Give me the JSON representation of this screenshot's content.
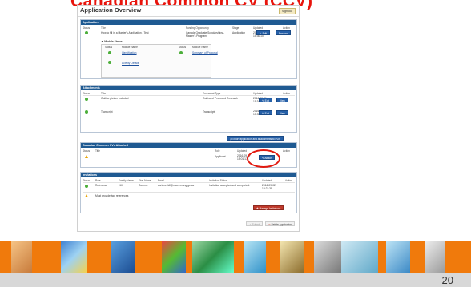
{
  "slide": {
    "title": "Canadian Common CV (CCV)",
    "page_number": "20"
  },
  "app": {
    "title": "Application Overview",
    "signout_label": "Sign out"
  },
  "application": {
    "section": "Application",
    "headers": [
      "Status",
      "Title",
      "Funding Opportunity",
      "Stage",
      "Updated",
      "Action"
    ],
    "row": {
      "title": "How to fill in a Master's Application - Test",
      "funding": "Canada Graduate Scholarships - Master's Program",
      "stage": "Application",
      "updated": "2016-09-01 15:30:10",
      "edit_label": "Edit",
      "preview_label": "Preview"
    },
    "module_status_label": "Module Status",
    "module_headers": [
      "Status",
      "Module Name",
      "Status",
      "Module Name"
    ],
    "modules": [
      "Identification",
      "Summary of Proposal",
      "Activity Details"
    ]
  },
  "attachments": {
    "section": "Attachments",
    "headers": [
      "Status",
      "Title",
      "Document Type",
      "Updated",
      "Action"
    ],
    "rows": [
      {
        "title": "Outline picture included",
        "doc_type": "Outline of Proposed Research",
        "updated": "2016-09-01 15:34:34",
        "edit": "Edit",
        "view": "View"
      },
      {
        "title": "Transcript",
        "doc_type": "Transcripts",
        "updated": "2016-09-01 15:35:48",
        "edit": "Edit",
        "view": "View"
      }
    ],
    "export_label": "Export application and attachments to PDF"
  },
  "ccv": {
    "section": "Canadian Common CVs Attached",
    "headers": [
      "Status",
      "Title",
      "Role",
      "Updated",
      "Action"
    ],
    "row": {
      "role": "Applicant",
      "updated": "2016-09-07 15:01:17",
      "attach_label": "Attach"
    }
  },
  "invitations": {
    "section": "Invitations",
    "headers": [
      "Status",
      "Role",
      "Family Name",
      "First Name",
      "Email",
      "Invitation Status",
      "Updated",
      "Action"
    ],
    "row": {
      "role": "Reference",
      "family": "Hill",
      "first": "Corinne",
      "email": "corinne.hill@nserc-crsng.gc.ca",
      "status": "Invitation accepted and completed.",
      "updated": "2016-09-02 13:21:39"
    },
    "warning": "Must provide two references",
    "manage_label": "Manage Invitations"
  },
  "footer": {
    "submit_label": "Submit",
    "delete_label": "Delete Application"
  },
  "colors": {
    "accent_orange": "#f07a0c",
    "panel_header": "#1f5a92",
    "highlight_red": "#e2190f"
  }
}
